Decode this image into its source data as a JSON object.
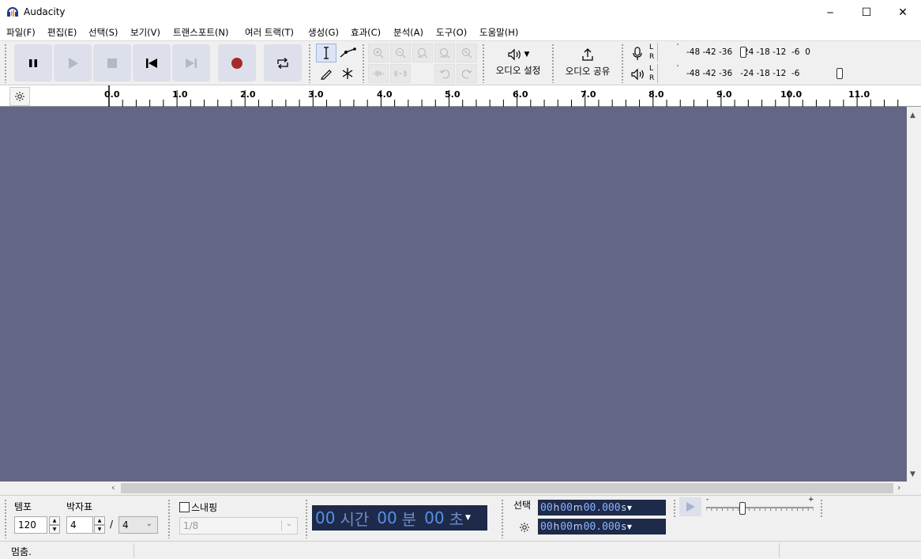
{
  "window": {
    "title": "Audacity",
    "controls": {
      "minimize": "─",
      "maximize": "☐",
      "close": "✕"
    }
  },
  "menu": [
    "파일(F)",
    "편집(E)",
    "선택(S)",
    "보기(V)",
    "트랜스포트(N)",
    "여러 트랙(T)",
    "생성(G)",
    "효과(C)",
    "분석(A)",
    "도구(O)",
    "도움말(H)"
  ],
  "transport": {
    "pause": "pause-icon",
    "play": "play-icon",
    "stop": "stop-icon",
    "skip_start": "skip-start-icon",
    "skip_end": "skip-end-icon",
    "record": "record-icon",
    "loop": "loop-icon",
    "record_color": "#a52a2a"
  },
  "tools": [
    "selection",
    "envelope",
    "draw",
    "multi"
  ],
  "audio_setup": {
    "label": "오디오 설정"
  },
  "share_audio": {
    "label": "오디오 공유"
  },
  "meters": {
    "channels": [
      "L",
      "R"
    ],
    "scale": [
      "-48",
      "-42",
      "-36",
      "-24",
      "-18",
      "-12",
      "-6",
      "0"
    ]
  },
  "ruler": {
    "labels": [
      "0.0",
      "1.0",
      "2.0",
      "3.0",
      "4.0",
      "5.0",
      "6.0",
      "7.0",
      "8.0",
      "9.0",
      "10.0",
      "11.0"
    ]
  },
  "tempo": {
    "label": "템포",
    "value": "120"
  },
  "time_signature": {
    "label": "박자표",
    "upper": "4",
    "separator": "/",
    "lower": "4"
  },
  "snapping": {
    "label": "스내핑",
    "checked": false,
    "value": "1/8"
  },
  "time_display": {
    "h": "00",
    "h_unit": "시간",
    "m": "00",
    "m_unit": "분",
    "s": "00",
    "s_unit": "초"
  },
  "selection": {
    "label": "선택",
    "start": {
      "h": "00",
      "m": "00",
      "s": "00.000",
      "h_unit": "h",
      "m_unit": "m",
      "s_unit": "s"
    },
    "end": {
      "h": "00",
      "m": "00",
      "s": "00.000",
      "h_unit": "h",
      "m_unit": "m",
      "s_unit": "s"
    }
  },
  "play_at_speed": {
    "minus": "-",
    "plus": "+"
  },
  "status": {
    "text": "멈춤."
  },
  "colors": {
    "track_bg": "#636684",
    "button_bg": "#dde0ea",
    "time_bg": "#1d2a49",
    "time_fg": "#5b8ee6"
  }
}
